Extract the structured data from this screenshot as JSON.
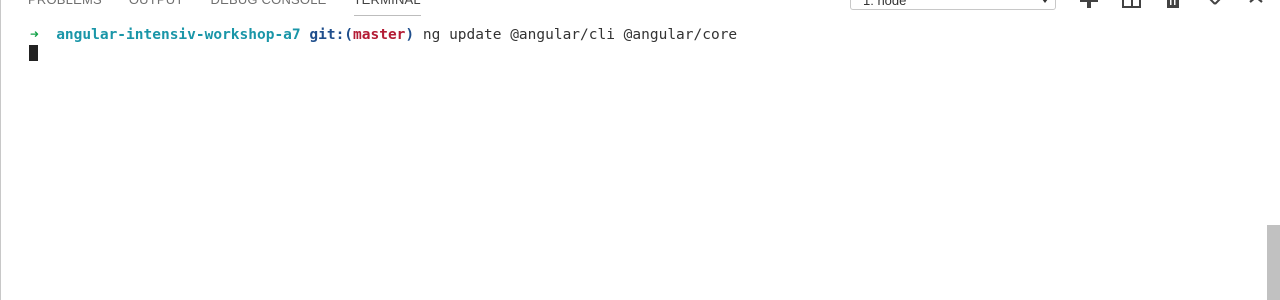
{
  "tabs": [
    {
      "label": "PROBLEMS"
    },
    {
      "label": "OUTPUT"
    },
    {
      "label": "DEBUG CONSOLE"
    },
    {
      "label": "TERMINAL"
    }
  ],
  "active_tab": "TERMINAL",
  "terminal_selector": {
    "selected": "1: node"
  },
  "toolbar": {
    "icons": [
      "plus-icon",
      "split-icon",
      "trash-icon",
      "chevron-up-icon",
      "close-icon"
    ]
  },
  "terminal": {
    "prompt_arrow": "➜",
    "directory": "angular-intensiv-workshop-a7",
    "git_prefix": "git:(",
    "branch": "master",
    "git_suffix": ")",
    "command": "ng update @angular/cli @angular/core"
  },
  "colors": {
    "arrow": "#16a34a",
    "directory": "#1a96a8",
    "git": "#1f4e8c",
    "branch": "#b31b34"
  }
}
